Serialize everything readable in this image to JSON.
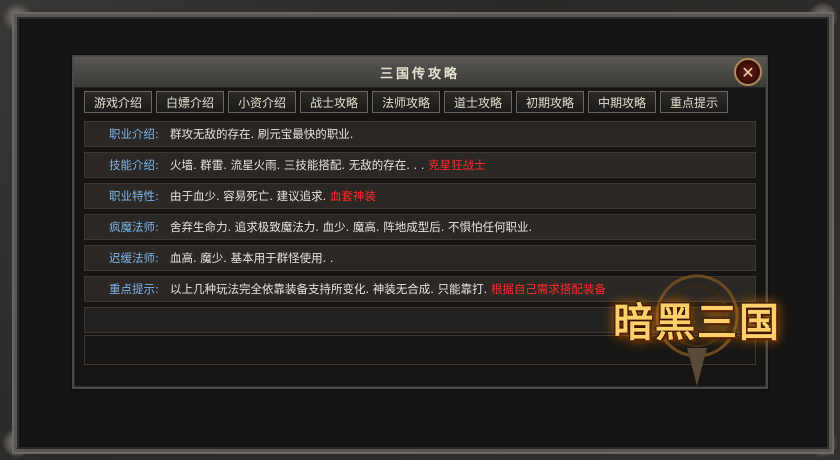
{
  "window": {
    "title": "三国传攻略",
    "close_icon": "close-x-icon"
  },
  "tabs": [
    {
      "label": "游戏介绍"
    },
    {
      "label": "白嫖介绍"
    },
    {
      "label": "小资介绍"
    },
    {
      "label": "战士攻略"
    },
    {
      "label": "法师攻略"
    },
    {
      "label": "道士攻略"
    },
    {
      "label": "初期攻略"
    },
    {
      "label": "中期攻略"
    },
    {
      "label": "重点提示"
    }
  ],
  "rows": [
    {
      "label": "职业介绍:",
      "text": "群攻无敌的存在. 刷元宝最快的职业.",
      "highlight": ""
    },
    {
      "label": "技能介绍:",
      "text": "火墙. 群雷. 流星火雨. 三技能搭配. 无敌的存在. . . ",
      "highlight": "克星狂战士"
    },
    {
      "label": "职业特性:",
      "text": "由于血少. 容易死亡. 建议追求. ",
      "highlight": "血套神装"
    },
    {
      "label": "疯魔法师:",
      "text": "舍弃生命力. 追求极致魔法力. 血少. 魔高. 阵地成型后. 不惧怕任何职业.",
      "highlight": ""
    },
    {
      "label": "迟缓法师:",
      "text": "血高. 魔少. 基本用于群怪使用. .",
      "highlight": ""
    },
    {
      "label": "重点提示:",
      "text": "以上几种玩法完全依靠装备支持所变化. 神装无合成. 只能靠打. ",
      "highlight": "根据自己需求搭配装备"
    }
  ],
  "logo": {
    "text": "暗黑三国",
    "colors": {
      "gold": "#ffcf6a",
      "shadow": "#7a2a00"
    }
  },
  "colors": {
    "label_blue": "#7fb4e8",
    "highlight_red": "#ff2b2b",
    "text_light": "#e8e4dc"
  }
}
